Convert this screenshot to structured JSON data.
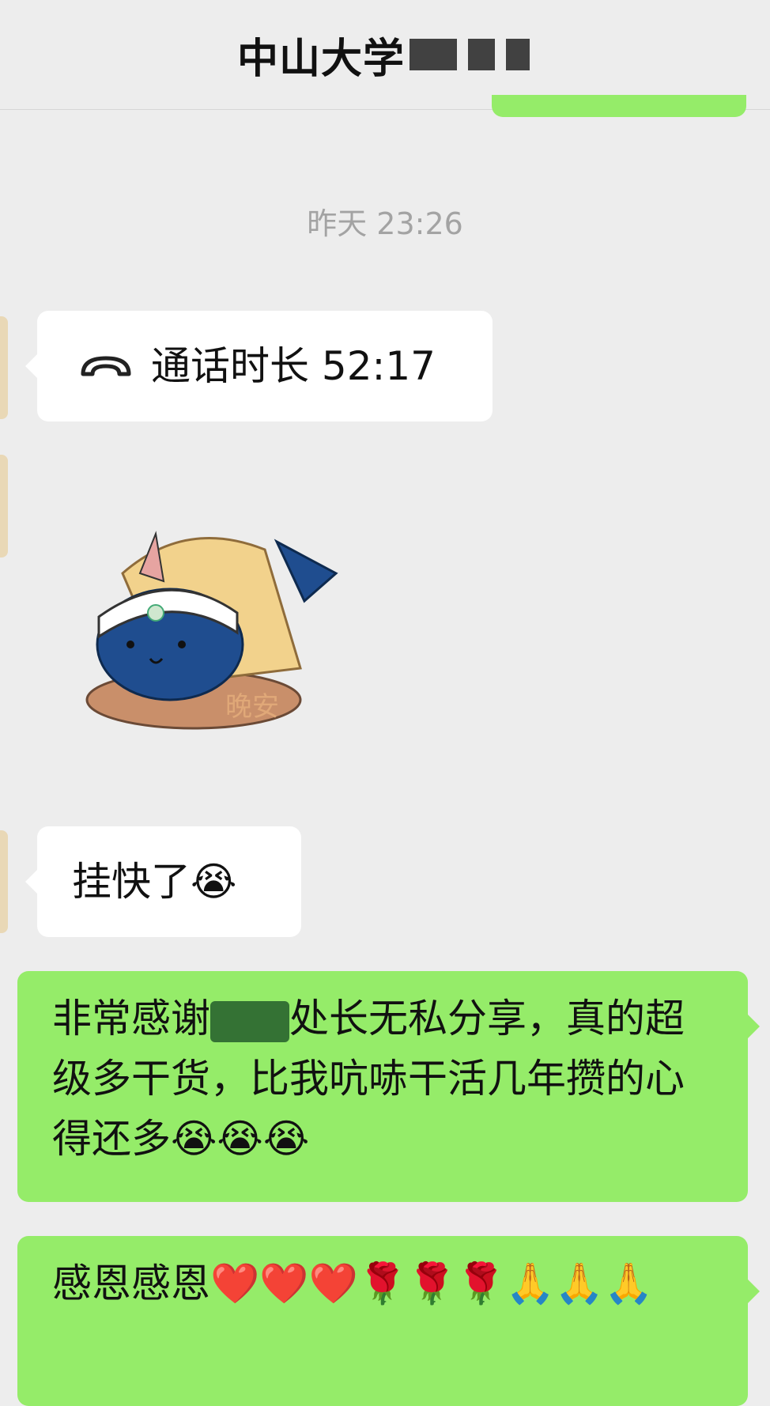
{
  "header": {
    "title": "中山大学",
    "title_redacted": true
  },
  "timestamp": "昨天 23:26",
  "messages": {
    "call": {
      "icon": "phone-hangup-icon",
      "text": "通话时长 52:17"
    },
    "sticker": {
      "text": "晚安",
      "icon": "narwhal-sticker-icon"
    },
    "short": {
      "text": "挂快了😭"
    },
    "long": {
      "before": "非常感谢",
      "after": "处长无私分享，真的超级多干货，比我吭哧干活几年攒的心得还多😭😭😭"
    },
    "thanks": {
      "text": "感恩感恩❤️❤️❤️🌹🌹🌹🙏🙏🙏"
    }
  },
  "colors": {
    "background": "#ededed",
    "self_bubble": "#95ec69",
    "other_bubble": "#ffffff"
  }
}
